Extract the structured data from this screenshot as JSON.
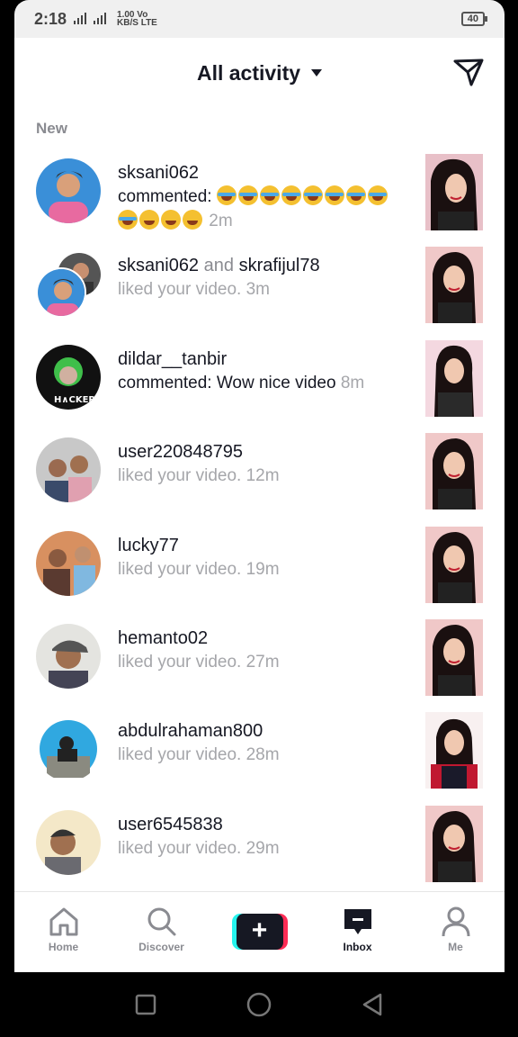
{
  "status_bar": {
    "time": "2:18",
    "network_top": "1.00 Vo",
    "network_bottom": "KB/S LTE",
    "battery": "40"
  },
  "header": {
    "title": "All activity"
  },
  "section_label": "New",
  "notifications": [
    {
      "username": "sksani062",
      "second_user": "",
      "message": "commented:",
      "time": "2m",
      "emoji_count": 11
    },
    {
      "username": "sksani062",
      "second_user": "skrafijul78",
      "message": "liked your video.",
      "time": "3m"
    },
    {
      "username": "dildar__tanbir",
      "second_user": "",
      "message": "commented: Wow nice video",
      "time": "8m"
    },
    {
      "username": "user220848795",
      "second_user": "",
      "message": "liked your video.",
      "time": "12m"
    },
    {
      "username": "lucky77",
      "second_user": "",
      "message": "liked your video.",
      "time": "19m"
    },
    {
      "username": "hemanto02",
      "second_user": "",
      "message": "liked your video.",
      "time": "27m"
    },
    {
      "username": "abdulrahaman800",
      "second_user": "",
      "message": "liked your video.",
      "time": "28m"
    },
    {
      "username": "user6545838",
      "second_user": "",
      "message": "liked your video.",
      "time": "29m"
    }
  ],
  "and_word": "and",
  "tabs": {
    "home": "Home",
    "discover": "Discover",
    "inbox": "Inbox",
    "me": "Me"
  },
  "colors": {
    "text_primary": "#161823",
    "text_secondary": "#a5a6aa",
    "accent_cyan": "#25f4ee",
    "accent_red": "#fe2c55"
  }
}
